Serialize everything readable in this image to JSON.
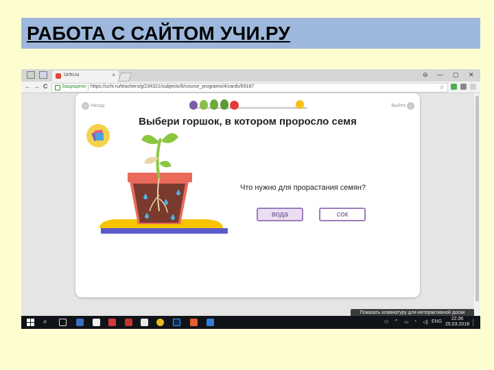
{
  "slide": {
    "title": "РАБОТА С САЙТОМ УЧИ.РУ"
  },
  "browser": {
    "tab_title": "Uchi.ru",
    "tab_close": "×",
    "address": {
      "secure_label": "Защищено",
      "url": "https://uchi.ru/teachers/g/234321/subjects/6/course_programs/4/cards/69187"
    },
    "window_controls": [
      "⊖",
      "—",
      "▢",
      "✕"
    ],
    "nav": {
      "back": "←",
      "forward": "→",
      "reload": "C"
    },
    "star": "☆"
  },
  "lesson": {
    "back_label": "Назад",
    "exit_label": "Выйти",
    "title": "Выбери горшок, в котором проросло семя",
    "question": "Что нужно для прорастания семян?",
    "answers": [
      "вода",
      "сок"
    ]
  },
  "colors": {
    "slide_background": "#fefdd0",
    "title_bar": "#9db8dc",
    "answer_border": "#9c7bbb",
    "answer_selected_fill": "#eadff2",
    "pot": "#e96a5b",
    "stand": "#f7c300"
  },
  "system": {
    "keyboard_hint": "Показать клавиатуру для интерактивной доски",
    "language": "ENG",
    "time": "22:36",
    "date": "25.03.2018"
  }
}
